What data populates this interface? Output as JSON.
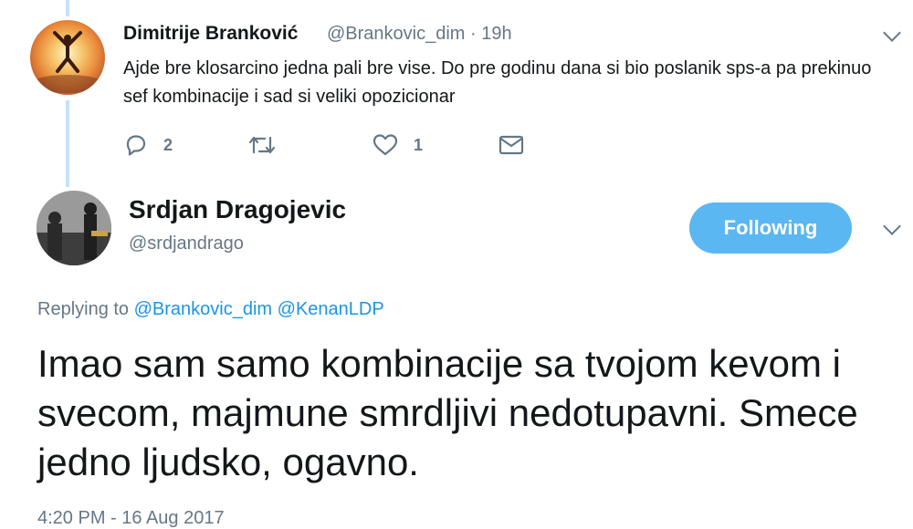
{
  "parent_tweet": {
    "author_name": "Dimitrije Branković",
    "author_handle": "@Brankovic_dim",
    "time": "19h",
    "text": "Ajde bre klosarcino jedna pali bre vise. Do pre godinu dana si bio poslanik sps-a pa prekinuo sef kombinacije i sad si veliki opozicionar",
    "reply_count": "2",
    "retweet_count": "",
    "like_count": "1",
    "icons": {
      "reply": "reply-icon",
      "retweet": "retweet-icon",
      "like": "heart-icon",
      "dm": "envelope-icon",
      "menu": "chevron-down-icon"
    }
  },
  "main_tweet": {
    "author_name": "Srdjan Dragojevic",
    "author_handle": "@srdjandrago",
    "follow_label": "Following",
    "replying_prefix": "Replying to",
    "replying_mentions": [
      "@Brankovic_dim",
      "@KenanLDP"
    ],
    "text": "Imao sam samo kombinacije sa tvojom kevom i svecom, majmune smrdljivi nedotupavni. Smece jedno ljudsko, ogavno.",
    "timestamp": "4:20 PM - 16 Aug 2017"
  },
  "colors": {
    "thread_line": "#c4e3f8",
    "follow_button": "#5ab7f1",
    "mention": "#1b95e0",
    "secondary_text": "#657786",
    "primary_text": "#14171a"
  }
}
